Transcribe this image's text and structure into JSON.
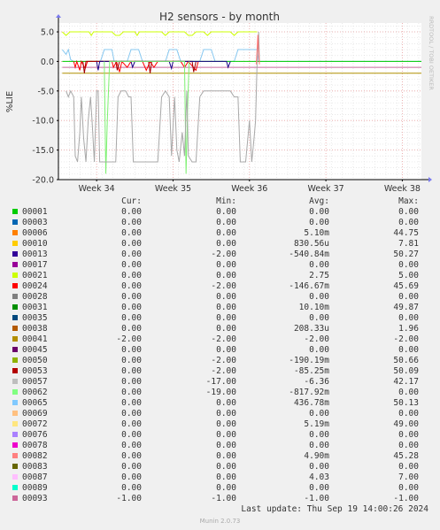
{
  "side_label": "RRDTOOL / TOBI OETIKER",
  "chart_data": {
    "type": "line",
    "title": "H2 sensors - by month",
    "ylabel": "%LIE",
    "ylim": [
      -20,
      6.5
    ],
    "yticks": [
      5.0,
      0.0,
      -5.0,
      -10.0,
      -15.0,
      -20.0
    ],
    "ytick_labels": [
      "5.0",
      "0.0",
      "-5.0",
      "-10.0",
      "-15.0",
      "-20.0"
    ],
    "xlim": [
      33.5,
      38.25
    ],
    "xticks": [
      34,
      35,
      36,
      37,
      38
    ],
    "xtick_labels": [
      "Week 34",
      "Week 35",
      "Week 36",
      "Week 37",
      "Week 38"
    ],
    "grid": true,
    "series": [
      {
        "name": "00021",
        "color": "#ccff00",
        "points": [
          [
            33.55,
            5.0
          ],
          [
            33.6,
            4.4
          ],
          [
            33.65,
            5.0
          ],
          [
            33.9,
            5.0
          ],
          [
            33.93,
            4.4
          ],
          [
            33.96,
            5.0
          ],
          [
            34.2,
            5.0
          ],
          [
            34.25,
            4.4
          ],
          [
            34.3,
            4.4
          ],
          [
            34.35,
            5.0
          ],
          [
            34.5,
            5.0
          ],
          [
            34.53,
            4.4
          ],
          [
            34.56,
            5.0
          ],
          [
            34.85,
            5.0
          ],
          [
            34.9,
            4.4
          ],
          [
            34.95,
            5.0
          ],
          [
            35.15,
            5.0
          ],
          [
            35.2,
            4.4
          ],
          [
            35.25,
            4.4
          ],
          [
            35.3,
            5.0
          ],
          [
            35.4,
            5.0
          ],
          [
            35.45,
            4.4
          ],
          [
            35.5,
            5.0
          ],
          [
            35.75,
            5.0
          ],
          [
            35.8,
            4.4
          ],
          [
            35.85,
            5.0
          ],
          [
            36.1,
            5.0
          ]
        ]
      },
      {
        "name": "00065",
        "color": "#88c8f0",
        "points": [
          [
            33.55,
            2.0
          ],
          [
            33.6,
            1.2
          ],
          [
            33.63,
            2.0
          ],
          [
            33.66,
            0.3
          ],
          [
            33.7,
            0.0
          ],
          [
            34.05,
            0.0
          ],
          [
            34.1,
            2.0
          ],
          [
            34.2,
            2.0
          ],
          [
            34.23,
            0.0
          ],
          [
            34.4,
            0.0
          ],
          [
            34.45,
            2.0
          ],
          [
            34.55,
            2.0
          ],
          [
            34.6,
            0.0
          ],
          [
            34.9,
            0.0
          ],
          [
            34.95,
            2.0
          ],
          [
            35.05,
            2.0
          ],
          [
            35.1,
            0.0
          ],
          [
            35.35,
            0.0
          ],
          [
            35.4,
            2.0
          ],
          [
            35.5,
            2.0
          ],
          [
            35.55,
            0.0
          ],
          [
            35.8,
            0.0
          ],
          [
            35.85,
            2.0
          ],
          [
            36.1,
            2.0
          ],
          [
            36.12,
            0.0
          ],
          [
            38.25,
            0.0
          ]
        ]
      },
      {
        "name": "00001",
        "color": "#00cc00",
        "points": [
          [
            33.55,
            0.0
          ],
          [
            38.25,
            0.0
          ]
        ]
      },
      {
        "name": "00093",
        "color": "#c8689c",
        "points": [
          [
            33.55,
            -1.0
          ],
          [
            38.25,
            -1.0
          ]
        ]
      },
      {
        "name": "00041",
        "color": "#b09000",
        "points": [
          [
            33.55,
            -2.0
          ],
          [
            38.25,
            -2.0
          ]
        ]
      },
      {
        "name": "00024",
        "color": "#ff0000",
        "points": [
          [
            33.7,
            0.0
          ],
          [
            33.72,
            -1.0
          ],
          [
            33.74,
            0.0
          ],
          [
            33.78,
            -1.5
          ],
          [
            33.8,
            0.0
          ],
          [
            33.85,
            -1.2
          ],
          [
            33.88,
            0.0
          ],
          [
            34.2,
            0.0
          ],
          [
            34.22,
            -1.0
          ],
          [
            34.26,
            0.0
          ],
          [
            34.3,
            -1.8
          ],
          [
            34.33,
            0.0
          ],
          [
            34.4,
            -1.0
          ],
          [
            34.45,
            0.0
          ],
          [
            34.6,
            0.0
          ],
          [
            34.65,
            -1.5
          ],
          [
            34.7,
            0.0
          ],
          [
            34.75,
            -1.0
          ],
          [
            34.8,
            0.0
          ],
          [
            35.1,
            0.0
          ],
          [
            35.15,
            -1.0
          ],
          [
            35.2,
            0.0
          ],
          [
            35.3,
            -1.5
          ],
          [
            35.33,
            0.0
          ]
        ]
      },
      {
        "name": "00053",
        "color": "#a00000",
        "points": [
          [
            33.82,
            0.0
          ],
          [
            33.84,
            -2.0
          ],
          [
            33.86,
            0.0
          ],
          [
            34.25,
            0.0
          ],
          [
            34.27,
            -1.5
          ],
          [
            34.3,
            0.0
          ],
          [
            34.68,
            0.0
          ],
          [
            34.7,
            -2.0
          ],
          [
            34.72,
            0.0
          ],
          [
            35.25,
            0.0
          ],
          [
            35.27,
            -1.8
          ],
          [
            35.3,
            0.0
          ]
        ]
      },
      {
        "name": "00013",
        "color": "#1a0088",
        "points": [
          [
            34.0,
            0.0
          ],
          [
            34.02,
            -1.5
          ],
          [
            34.04,
            0.0
          ],
          [
            34.45,
            0.0
          ],
          [
            34.47,
            -1.0
          ],
          [
            34.5,
            0.0
          ],
          [
            34.95,
            0.0
          ],
          [
            34.98,
            -1.2
          ],
          [
            35.0,
            0.0
          ],
          [
            35.7,
            0.0
          ],
          [
            35.72,
            -1.0
          ],
          [
            35.75,
            0.0
          ]
        ]
      },
      {
        "name": "00062",
        "color": "#7cf070",
        "points": [
          [
            34.1,
            0.0
          ],
          [
            34.12,
            -19.0
          ],
          [
            34.14,
            -10.0
          ],
          [
            34.17,
            0.0
          ],
          [
            35.15,
            0.0
          ],
          [
            35.17,
            -19.0
          ],
          [
            35.19,
            -8.0
          ],
          [
            35.21,
            0.0
          ]
        ]
      },
      {
        "name": "00057",
        "color": "#a8a8a8",
        "points": [
          [
            33.6,
            -5.0
          ],
          [
            33.63,
            -6.0
          ],
          [
            33.66,
            -5.0
          ],
          [
            33.7,
            -6.0
          ],
          [
            33.72,
            -16.0
          ],
          [
            33.75,
            -17.0
          ],
          [
            33.78,
            -12.0
          ],
          [
            33.8,
            -6.0
          ],
          [
            33.83,
            -13.0
          ],
          [
            33.86,
            -17.0
          ],
          [
            33.89,
            -10.0
          ],
          [
            33.92,
            -6.0
          ],
          [
            33.94,
            -10.0
          ],
          [
            33.97,
            -17.0
          ],
          [
            34.0,
            -5.0
          ],
          [
            34.02,
            -5.0
          ],
          [
            34.04,
            -17.0
          ],
          [
            34.1,
            -17.0
          ],
          [
            34.25,
            -17.0
          ],
          [
            34.28,
            -6.0
          ],
          [
            34.32,
            -5.0
          ],
          [
            34.38,
            -5.0
          ],
          [
            34.42,
            -6.0
          ],
          [
            34.45,
            -6.0
          ],
          [
            34.48,
            -17.0
          ],
          [
            34.8,
            -17.0
          ],
          [
            34.85,
            -6.0
          ],
          [
            34.9,
            -5.0
          ],
          [
            34.95,
            -6.0
          ],
          [
            34.98,
            -16.0
          ],
          [
            35.02,
            -6.0
          ],
          [
            35.05,
            -15.0
          ],
          [
            35.08,
            -17.0
          ],
          [
            35.12,
            -12.0
          ],
          [
            35.15,
            -16.0
          ],
          [
            35.18,
            -5.0
          ],
          [
            35.2,
            -16.0
          ],
          [
            35.25,
            -17.0
          ],
          [
            35.3,
            -17.0
          ],
          [
            35.35,
            -6.0
          ],
          [
            35.4,
            -5.0
          ],
          [
            35.7,
            -5.0
          ],
          [
            35.75,
            -5.0
          ],
          [
            35.8,
            -6.0
          ],
          [
            35.85,
            -6.0
          ],
          [
            35.88,
            -17.0
          ],
          [
            35.95,
            -17.0
          ],
          [
            36.0,
            -10.0
          ],
          [
            36.03,
            -17.0
          ],
          [
            36.06,
            -13.0
          ],
          [
            36.08,
            -10.0
          ],
          [
            36.1,
            0.0
          ],
          [
            36.12,
            5.0
          ],
          [
            36.13,
            0.0
          ]
        ]
      },
      {
        "name": "00082",
        "color": "#ff7070",
        "points": [
          [
            36.09,
            -0.5
          ],
          [
            36.11,
            4.5
          ],
          [
            36.13,
            -0.5
          ]
        ]
      }
    ],
    "legend": {
      "headers": {
        "cur": "Cur:",
        "min": "Min:",
        "avg": "Avg:",
        "max": "Max:"
      },
      "rows": [
        {
          "name": "00001",
          "color": "#00cc00",
          "cur": "0.00",
          "min": "0.00",
          "avg": "0.00",
          "max": "0.00"
        },
        {
          "name": "00003",
          "color": "#0066b3",
          "cur": "0.00",
          "min": "0.00",
          "avg": "0.00",
          "max": "0.00"
        },
        {
          "name": "00006",
          "color": "#ff8000",
          "cur": "0.00",
          "min": "0.00",
          "avg": "5.10m",
          "max": "44.75"
        },
        {
          "name": "00010",
          "color": "#ffcc00",
          "cur": "0.00",
          "min": "0.00",
          "avg": "830.56u",
          "max": "7.81"
        },
        {
          "name": "00013",
          "color": "#330099",
          "cur": "0.00",
          "min": "-2.00",
          "avg": "-540.84m",
          "max": "50.27"
        },
        {
          "name": "00017",
          "color": "#990099",
          "cur": "0.00",
          "min": "0.00",
          "avg": "0.00",
          "max": "0.00"
        },
        {
          "name": "00021",
          "color": "#ccff00",
          "cur": "0.00",
          "min": "0.00",
          "avg": "2.75",
          "max": "5.00"
        },
        {
          "name": "00024",
          "color": "#ff0000",
          "cur": "0.00",
          "min": "-2.00",
          "avg": "-146.67m",
          "max": "45.69"
        },
        {
          "name": "00028",
          "color": "#808080",
          "cur": "0.00",
          "min": "0.00",
          "avg": "0.00",
          "max": "0.00"
        },
        {
          "name": "00031",
          "color": "#008f00",
          "cur": "0.00",
          "min": "0.00",
          "avg": "10.10m",
          "max": "49.87"
        },
        {
          "name": "00035",
          "color": "#00487d",
          "cur": "0.00",
          "min": "0.00",
          "avg": "0.00",
          "max": "0.00"
        },
        {
          "name": "00038",
          "color": "#b35a00",
          "cur": "0.00",
          "min": "0.00",
          "avg": "208.33u",
          "max": "1.96"
        },
        {
          "name": "00041",
          "color": "#b38f00",
          "cur": "-2.00",
          "min": "-2.00",
          "avg": "-2.00",
          "max": "-2.00"
        },
        {
          "name": "00045",
          "color": "#6b006b",
          "cur": "0.00",
          "min": "0.00",
          "avg": "0.00",
          "max": "0.00"
        },
        {
          "name": "00050",
          "color": "#8fb300",
          "cur": "0.00",
          "min": "-2.00",
          "avg": "-190.19m",
          "max": "50.66"
        },
        {
          "name": "00053",
          "color": "#b30000",
          "cur": "0.00",
          "min": "-2.00",
          "avg": "-85.25m",
          "max": "50.09"
        },
        {
          "name": "00057",
          "color": "#bebebe",
          "cur": "0.00",
          "min": "-17.00",
          "avg": "-6.36",
          "max": "42.17"
        },
        {
          "name": "00062",
          "color": "#80ff80",
          "cur": "0.00",
          "min": "-19.00",
          "avg": "-817.92m",
          "max": "0.00"
        },
        {
          "name": "00065",
          "color": "#80c9ff",
          "cur": "0.00",
          "min": "0.00",
          "avg": "436.78m",
          "max": "50.13"
        },
        {
          "name": "00069",
          "color": "#ffc080",
          "cur": "0.00",
          "min": "0.00",
          "avg": "0.00",
          "max": "0.00"
        },
        {
          "name": "00072",
          "color": "#ffe680",
          "cur": "0.00",
          "min": "0.00",
          "avg": "5.19m",
          "max": "49.00"
        },
        {
          "name": "00076",
          "color": "#aa80ff",
          "cur": "0.00",
          "min": "0.00",
          "avg": "0.00",
          "max": "0.00"
        },
        {
          "name": "00078",
          "color": "#ee00cc",
          "cur": "0.00",
          "min": "0.00",
          "avg": "0.00",
          "max": "0.00"
        },
        {
          "name": "00082",
          "color": "#ff8080",
          "cur": "0.00",
          "min": "0.00",
          "avg": "4.90m",
          "max": "45.28"
        },
        {
          "name": "00083",
          "color": "#666600",
          "cur": "0.00",
          "min": "0.00",
          "avg": "0.00",
          "max": "0.00"
        },
        {
          "name": "00087",
          "color": "#ffbfff",
          "cur": "0.00",
          "min": "0.00",
          "avg": "4.03",
          "max": "7.00"
        },
        {
          "name": "00089",
          "color": "#00ffcc",
          "cur": "0.00",
          "min": "0.00",
          "avg": "0.00",
          "max": "0.00"
        },
        {
          "name": "00093",
          "color": "#cc6699",
          "cur": "-1.00",
          "min": "-1.00",
          "avg": "-1.00",
          "max": "-1.00"
        }
      ]
    }
  },
  "footer": {
    "last_update": "Last update: Thu Sep 19 14:00:26 2024",
    "munin": "Munin 2.0.73"
  }
}
